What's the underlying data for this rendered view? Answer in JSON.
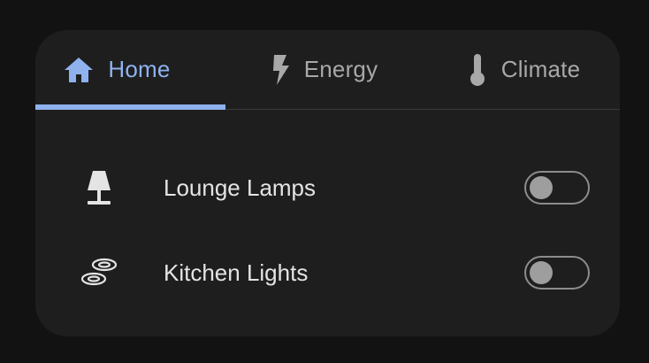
{
  "tabs": [
    {
      "label": "Home",
      "icon": "home-icon",
      "active": true
    },
    {
      "label": "Energy",
      "icon": "lightning-bolt-icon",
      "active": false
    },
    {
      "label": "Climate",
      "icon": "thermometer-icon",
      "active": false
    }
  ],
  "devices": [
    {
      "name": "Lounge Lamps",
      "icon": "table-lamp-icon",
      "on": false
    },
    {
      "name": "Kitchen Lights",
      "icon": "ceiling-lights-icon",
      "on": false
    }
  ],
  "colors": {
    "background": "#121212",
    "card": "#1e1e1e",
    "accent": "#8fb2ef",
    "inactive_text": "#a8a8a8",
    "text": "#e4e4e4"
  }
}
